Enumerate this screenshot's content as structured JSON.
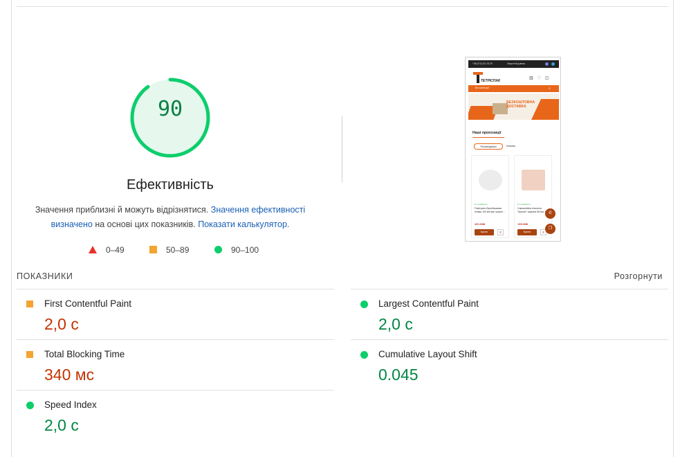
{
  "gauge": {
    "score": "90",
    "score_fraction": 0.9,
    "title": "Ефективність"
  },
  "description": {
    "text_1": "Значення приблизні й можуть відрізнятися. ",
    "link_1": "Значення ефективності визначено",
    "text_2": " на основі цих показників. ",
    "link_2": "Показати калькулятор."
  },
  "legend": {
    "fail": "0–49",
    "average": "50–89",
    "pass": "90–100"
  },
  "screenshot": {
    "phone": "+38 (073) 421 30 25",
    "callback": "Зворотній дзвінок",
    "logo_text": "ТЕТРІСПАК",
    "search_placeholder": "Всі категорії",
    "banner_text": "БЕЗКОШТОВНА ДОСТАВКА",
    "section_title": "Наші пропозиції",
    "tab_1": "Рекомендовані",
    "tab_2": "Новинки",
    "card_1": {
      "stock": "Є в наявності",
      "name": "Повітряно-бульбашкова плівка 100 метрів, ширин...",
      "price": "400.00₴",
      "buy": "Купити"
    },
    "card_2": {
      "stock": "Є в наявності",
      "name": "Самоклейка етикетка \"Крихке\" ширина 58 мм, 50...",
      "price": "195.00₴",
      "buy": "Купити"
    }
  },
  "metrics": {
    "title": "ПОКАЗНИКИ",
    "expand_label": "Розгорнути",
    "items": [
      {
        "name": "First Contentful Paint",
        "value": "2,0 с",
        "status": "average"
      },
      {
        "name": "Largest Contentful Paint",
        "value": "2,0 с",
        "status": "pass"
      },
      {
        "name": "Total Blocking Time",
        "value": "340 мс",
        "status": "average"
      },
      {
        "name": "Cumulative Layout Shift",
        "value": "0.045",
        "status": "pass"
      },
      {
        "name": "Speed Index",
        "value": "2,0 с",
        "status": "pass"
      }
    ]
  },
  "colors": {
    "pass": "#0cce6b",
    "average": "#f4a431",
    "fail": "#e8322d",
    "pass_text": "#018642",
    "average_text": "#c33300",
    "link": "#1a5fb4"
  }
}
